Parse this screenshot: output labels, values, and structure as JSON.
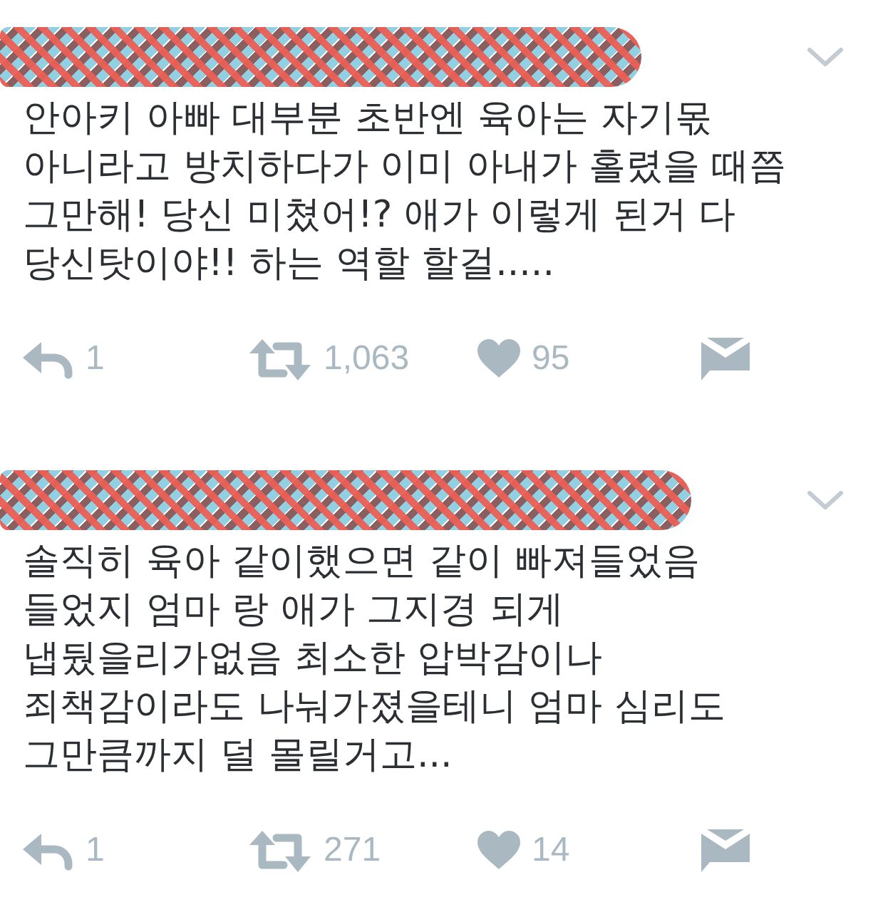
{
  "tweets": [
    {
      "text": "안아키 아빠 대부분 초반엔 육아는 자기몫\n아니라고 방치하다가 이미 아내가 홀렸을 때쯤\n그만해! 당신 미쳤어!? 애가 이렇게 된거 다\n당신탓이야!! 하는 역할 할걸.....",
      "replies": "1",
      "retweets": "1,063",
      "likes": "95"
    },
    {
      "text": "솔직히 육아 같이했으면 같이 빠져들었음\n들었지 엄마 랑 애가 그지경 되게\n냅뒀을리가없음 최소한 압박감이나\n죄책감이라도 나눠가졌을테니 엄마 심리도\n그만큼까지 덜 몰릴거고...",
      "replies": "1",
      "retweets": "271",
      "likes": "14"
    }
  ]
}
